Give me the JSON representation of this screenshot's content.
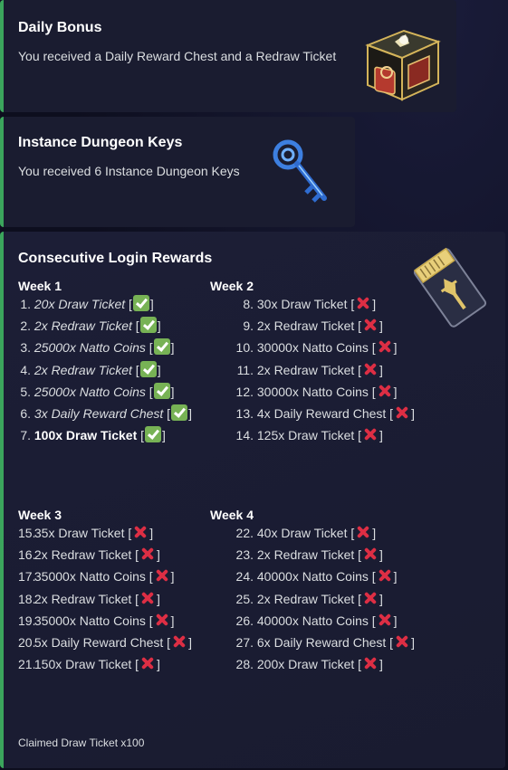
{
  "daily_bonus": {
    "title": "Daily Bonus",
    "description": "You received a Daily Reward Chest and a Redraw Ticket",
    "thumbnail_icon": "treasure-chest-icon"
  },
  "dungeon_keys": {
    "title": "Instance Dungeon Keys",
    "description": "You received 6 Instance Dungeon Keys",
    "thumbnail_icon": "key-icon"
  },
  "login_rewards": {
    "title": "Consecutive Login Rewards",
    "thumbnail_icon": "draw-ticket-icon",
    "accent_color": "#3ba55c",
    "weeks": [
      {
        "title": "Week 1",
        "items": [
          {
            "num": "1.",
            "text": "20x Draw Ticket",
            "status": "claimed"
          },
          {
            "num": "2.",
            "text": "2x Redraw Ticket",
            "status": "claimed"
          },
          {
            "num": "3.",
            "text": "25000x Natto Coins",
            "status": "claimed"
          },
          {
            "num": "4.",
            "text": "2x Redraw Ticket",
            "status": "claimed"
          },
          {
            "num": "5.",
            "text": "25000x Natto Coins",
            "status": "claimed"
          },
          {
            "num": "6.",
            "text": "3x Daily Reward Chest",
            "status": "claimed"
          },
          {
            "num": "7.",
            "text": "100x Draw Ticket",
            "status": "current"
          }
        ]
      },
      {
        "title": "Week 2",
        "items": [
          {
            "num": "8.",
            "text": "30x Draw Ticket",
            "status": "locked"
          },
          {
            "num": "9.",
            "text": "2x Redraw Ticket",
            "status": "locked"
          },
          {
            "num": "10.",
            "text": "30000x Natto Coins",
            "status": "locked"
          },
          {
            "num": "11.",
            "text": "2x Redraw Ticket",
            "status": "locked"
          },
          {
            "num": "12.",
            "text": "30000x Natto Coins",
            "status": "locked"
          },
          {
            "num": "13.",
            "text": "4x Daily Reward Chest",
            "status": "locked"
          },
          {
            "num": "14.",
            "text": "125x Draw Ticket",
            "status": "locked"
          }
        ]
      },
      {
        "title": "Week 3",
        "items": [
          {
            "num": "15.",
            "text": "35x Draw Ticket",
            "status": "locked"
          },
          {
            "num": "16.",
            "text": "2x Redraw Ticket",
            "status": "locked"
          },
          {
            "num": "17.",
            "text": "35000x Natto Coins",
            "status": "locked"
          },
          {
            "num": "18.",
            "text": "2x Redraw Ticket",
            "status": "locked"
          },
          {
            "num": "19.",
            "text": "35000x Natto Coins",
            "status": "locked"
          },
          {
            "num": "20.",
            "text": "5x Daily Reward Chest",
            "status": "locked"
          },
          {
            "num": "21.",
            "text": "150x Draw Ticket",
            "status": "locked"
          }
        ]
      },
      {
        "title": "Week 4",
        "items": [
          {
            "num": "22.",
            "text": "40x Draw Ticket",
            "status": "locked"
          },
          {
            "num": "23.",
            "text": "2x Redraw Ticket",
            "status": "locked"
          },
          {
            "num": "24.",
            "text": "40000x Natto Coins",
            "status": "locked"
          },
          {
            "num": "25.",
            "text": "2x Redraw Ticket",
            "status": "locked"
          },
          {
            "num": "26.",
            "text": "40000x Natto Coins",
            "status": "locked"
          },
          {
            "num": "27.",
            "text": "6x Daily Reward Chest",
            "status": "locked"
          },
          {
            "num": "28.",
            "text": "200x Draw Ticket",
            "status": "locked"
          }
        ]
      }
    ],
    "status_icons": {
      "claimed": "check-mark-icon",
      "current": "check-mark-icon",
      "locked": "cross-mark-icon"
    },
    "footer": "Claimed Draw Ticket x100"
  }
}
